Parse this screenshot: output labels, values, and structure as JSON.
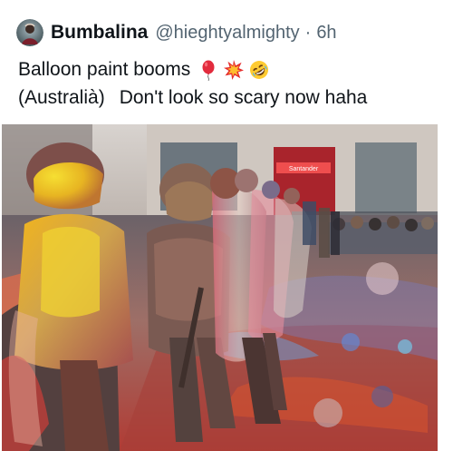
{
  "tweet": {
    "display_name": "Bumbalina",
    "handle": "@hieghtyalmighty",
    "separator": "·",
    "time": "6h",
    "text_line_1": "Balloon paint booms",
    "text_line_2a": "(Australià)",
    "text_line_2b": "Don't look so scary now haha",
    "emojis": [
      "balloon-emoji",
      "collision-emoji",
      "rolling-on-floor-laughing-emoji"
    ]
  },
  "photo": {
    "storefront_sign": "Santander",
    "subject": "riot police covered in colorful paint"
  },
  "colors": {
    "name": "#0f1419",
    "secondary": "#536471",
    "background": "#ffffff",
    "sign_red": "#d8232a"
  }
}
